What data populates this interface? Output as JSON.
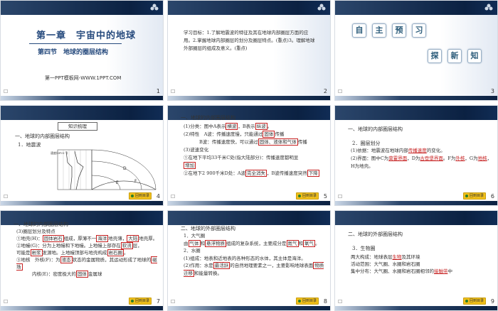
{
  "slides": [
    {
      "num": "1",
      "title": "第一章　宇宙中的地球",
      "subtitle": "第四节　地球的圈层结构",
      "footer": "第一PPT模板网-WWW.1PPT.COM"
    },
    {
      "num": "2",
      "text": "学习目标：1.了解地震波的特征及其在地球内部圈层方面的应用。2.掌握地球内部圈层的划分及圈层特点。(重点)3。理解地球外部圈层的组成及意义。(重点)"
    },
    {
      "num": "3",
      "chars1": [
        "自",
        "主",
        "预",
        "习"
      ],
      "chars2": [
        "探",
        "新",
        "知"
      ]
    },
    {
      "num": "4",
      "box": "知识梳理",
      "h1": "一、地球的内部圈层结构",
      "h2": "1．地震波",
      "chart_labels": {
        "ylabel": "速度(km·s⁻¹)",
        "depth_label": "深度(km)",
        "letters": [
          "A",
          "B",
          "C",
          "D",
          "E",
          "F"
        ]
      }
    },
    {
      "num": "5",
      "h1": "一、地球的内部圈层结构",
      "l1": "(1)分类：图中A表示",
      "a1": "横波",
      "l1b": "，B表示",
      "a2": "纵波",
      "l1c": "。",
      "l2": "(2)特性",
      "l2a": "A波：传播速度慢，只能通过",
      "a3": "固体",
      "l2a2": "传播",
      "l2b": "B波：传播速度快，可以通过",
      "a4": "固体、液体和气体",
      "l2b2": "传播",
      "l3": "(3)波速变化",
      "l4": "①在地下平均33千米C处(指大陆部分)：传播速度都明显",
      "a5": "增加",
      "l5": "②在地下2 900千米D处：A波",
      "a6": "完全消失",
      "l5b": "，B波传播速度突然",
      "a7": "下降"
    },
    {
      "num": "6",
      "h1": "一、地球的内部圈层结构",
      "h2": "2．圈层划分",
      "l1": "(1)依据：地震波在地球内部",
      "a1": "传播速度",
      "l1b": "的变化。",
      "l2": "(2)界面：图中C为",
      "a2": "莫霍界面",
      "l2b": "，D为",
      "a3": "古登堡界面",
      "l2c": "。F为",
      "a4": "外核",
      "l2d": "，G为",
      "a5": "地核",
      "l2e": "，H为地壳。"
    },
    {
      "num": "7",
      "h1": "一、地球的内部圈层结构",
      "h2": "(3)圈层划分及特点",
      "l1": "①地壳(H)：",
      "a1": "固体岩石",
      "l1b": "组成，厚薄不一",
      "a2": "海洋",
      "l1c": "地壳薄，",
      "a3": "大陆",
      "l1d": "地壳厚。",
      "l2": "②地幔(G)：分为上地幔和下地幔。上地幔上部存在",
      "a4": "软流",
      "l2b": "层，",
      "l3": "可能是",
      "a5": "岩浆",
      "l3b": "发源地。上地幔顶部与地壳构成",
      "a6": "岩石圈",
      "l3c": "。",
      "l4": "③地核",
      "l4a": "外核(F)：为",
      "a7": "液态",
      "l4a2": "状态的金属物质，其运动形成了地球的",
      "a8": "磁场",
      "l4b": "内核(E)：密度极大的",
      "a9": "固体",
      "l4b2": "金属球"
    },
    {
      "num": "8",
      "h1": "二、地球的外部圈层结构",
      "h2": "1．大气圈",
      "l1": "由",
      "a1": "气体",
      "l1b": "和",
      "a2": "悬浮物质",
      "l1c": "组成的复杂系统，主要成分是",
      "a3": "氮气",
      "l1d": "和",
      "a4": "氧气",
      "l1e": "。",
      "h3": "2．水圈",
      "l2": "(1)组成：地表和近地表的各种形态的水体，其主体是海洋。",
      "l3": "(2)作用：水是",
      "a5": "最活跃",
      "l3b": "的自然地理要素之一，主要影响地球表面",
      "a6": "物质迁移",
      "l3c": "和能量转换。"
    },
    {
      "num": "9",
      "h1": "二、地球的外部圈层结构",
      "h2": "3．生物圈",
      "l1": "两大构成：地球表层",
      "a1": "生物",
      "l1b": "及其环境",
      "l2": "活动范围：大气圈、水圈和岩石圈",
      "l3": "集中分布：大气圈、水圈和岩石圈相邻的",
      "a2": "接触带",
      "l3b": "中"
    }
  ],
  "mini_button": "回到目录"
}
